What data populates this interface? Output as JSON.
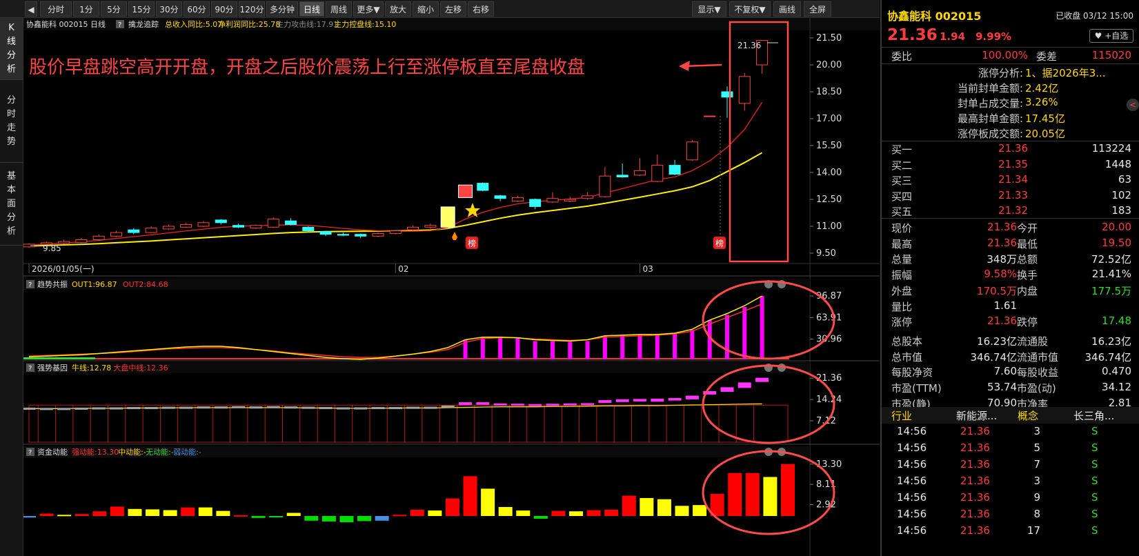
{
  "toolbar": {
    "items": [
      "分时",
      "1分",
      "5分",
      "15分",
      "30分",
      "60分",
      "90分",
      "120分",
      "多分钟",
      "日线",
      "周线",
      "更多▼",
      "放大",
      "缩小",
      "左移",
      "右移"
    ],
    "active": "日线",
    "right_items": [
      "显示▼",
      "不复权▼",
      "画线",
      "全屏"
    ]
  },
  "sidebar": {
    "tabs": [
      {
        "label": "K\n线\n分\n析",
        "active": true
      },
      {
        "label": "分\n时\n走\n势",
        "active": false
      },
      {
        "label": "基\n本\n面\n分\n析",
        "active": false
      }
    ]
  },
  "main_chart": {
    "header": {
      "name": "协鑫能科 002015 日线",
      "indicator": "擒龙追踪",
      "items": [
        {
          "label": "总收入同比:5.07",
          "color": "#ffd800"
        },
        {
          "label": "净利润同比:25.78",
          "color": "#ffd800"
        },
        {
          "label": "主力攻击线:17.91",
          "color": "#888888"
        },
        {
          "label": "主力控盘线:15.10",
          "color": "#ffd800"
        }
      ]
    },
    "y_ticks": [
      "21.50",
      "20.00",
      "18.50",
      "17.00",
      "15.50",
      "14.00",
      "12.50",
      "11.00",
      "9.50"
    ],
    "y_range": [
      9.0,
      22.0
    ],
    "x_labels": [
      {
        "label": "2026/01/05(一)",
        "index": 0
      },
      {
        "label": "02",
        "index": 21
      },
      {
        "label": "03",
        "index": 35
      }
    ],
    "annotation": "股价早盘跳空高开开盘，开盘之后股价震荡上行至涨停板直至尾盘收盘",
    "low_label": "9.85",
    "high_label": "21.36",
    "badge": "榜",
    "candles": [
      [
        9.85,
        10.0,
        10.05,
        9.8
      ],
      [
        10.0,
        10.08,
        10.15,
        9.95
      ],
      [
        10.05,
        10.15,
        10.25,
        10.0
      ],
      [
        10.1,
        10.25,
        10.35,
        10.05
      ],
      [
        10.25,
        10.45,
        10.55,
        10.2
      ],
      [
        10.45,
        10.65,
        10.75,
        10.4
      ],
      [
        10.8,
        10.65,
        10.9,
        10.55
      ],
      [
        10.65,
        10.9,
        11.0,
        10.6
      ],
      [
        10.85,
        11.0,
        11.1,
        10.8
      ],
      [
        10.95,
        11.1,
        11.2,
        10.9
      ],
      [
        11.0,
        11.2,
        11.3,
        10.95
      ],
      [
        11.35,
        11.2,
        11.4,
        11.1
      ],
      [
        11.05,
        10.95,
        11.15,
        10.9
      ],
      [
        10.9,
        11.05,
        11.1,
        10.85
      ],
      [
        10.95,
        11.4,
        11.5,
        10.9
      ],
      [
        11.3,
        11.1,
        11.45,
        11.05
      ],
      [
        10.95,
        10.75,
        11.0,
        10.65
      ],
      [
        10.7,
        10.55,
        10.75,
        10.45
      ],
      [
        10.55,
        10.5,
        10.65,
        10.45
      ],
      [
        10.55,
        10.45,
        10.6,
        10.35
      ],
      [
        10.45,
        10.6,
        10.65,
        10.4
      ],
      [
        10.6,
        10.75,
        10.8,
        10.55
      ],
      [
        10.8,
        10.95,
        11.05,
        10.75
      ],
      [
        10.95,
        11.05,
        11.15,
        10.85
      ],
      [
        10.95,
        12.08,
        12.08,
        10.95
      ],
      [
        12.6,
        13.3,
        13.3,
        12.6
      ],
      [
        13.4,
        13.0,
        13.45,
        12.95
      ],
      [
        12.7,
        12.55,
        12.75,
        12.4
      ],
      [
        12.4,
        12.6,
        12.7,
        12.35
      ],
      [
        12.5,
        12.1,
        12.55,
        11.95
      ],
      [
        12.35,
        12.55,
        12.9,
        12.3
      ],
      [
        12.4,
        12.5,
        12.65,
        12.35
      ],
      [
        12.55,
        12.7,
        12.9,
        12.5
      ],
      [
        12.65,
        13.8,
        14.3,
        12.6
      ],
      [
        13.85,
        13.75,
        14.5,
        13.7
      ],
      [
        13.85,
        14.1,
        14.8,
        13.8
      ],
      [
        13.5,
        14.4,
        15.0,
        13.45
      ],
      [
        14.4,
        13.9,
        14.7,
        13.85
      ],
      [
        14.7,
        15.7,
        15.8,
        14.65
      ],
      [
        17.15,
        17.15,
        17.15,
        17.15
      ],
      [
        18.5,
        18.2,
        18.8,
        17.05
      ],
      [
        17.85,
        19.35,
        19.55,
        17.45
      ],
      [
        20.0,
        21.36,
        21.36,
        19.5
      ]
    ],
    "ma_fast": [
      9.95,
      10.0,
      10.07,
      10.13,
      10.21,
      10.32,
      10.42,
      10.52,
      10.63,
      10.74,
      10.84,
      10.94,
      11.0,
      11.03,
      11.06,
      11.08,
      11.05,
      10.97,
      10.88,
      10.8,
      10.75,
      10.72,
      10.72,
      10.75,
      10.93,
      11.4,
      11.78,
      12.05,
      12.25,
      12.36,
      12.45,
      12.52,
      12.6,
      12.86,
      13.1,
      13.35,
      13.6,
      13.75,
      14.1,
      14.65,
      15.4,
      16.4,
      17.91
    ],
    "ma_slow": [
      9.9,
      9.93,
      9.96,
      9.99,
      10.03,
      10.08,
      10.13,
      10.18,
      10.24,
      10.3,
      10.36,
      10.42,
      10.48,
      10.54,
      10.6,
      10.65,
      10.68,
      10.7,
      10.71,
      10.72,
      10.73,
      10.74,
      10.76,
      10.79,
      10.88,
      11.05,
      11.25,
      11.45,
      11.62,
      11.76,
      11.88,
      12.0,
      12.12,
      12.28,
      12.45,
      12.62,
      12.8,
      12.98,
      13.2,
      13.55,
      14.05,
      14.55,
      15.1
    ]
  },
  "panel1": {
    "name": "趋势共振",
    "items": [
      {
        "label": "OUT1:96.87",
        "color": "#ffd800"
      },
      {
        "label": "OUT2:84.68",
        "color": "#ff3030"
      }
    ],
    "y_ticks": [
      "96.87",
      "63.91",
      "30.96"
    ],
    "y_max": 100,
    "bars": [
      0,
      0,
      0,
      0,
      0,
      0,
      0,
      0,
      0,
      0,
      0,
      0,
      0,
      0,
      0,
      0,
      0,
      0,
      0,
      0,
      0,
      0,
      0,
      0,
      0,
      30,
      34,
      34,
      33,
      28,
      28,
      27,
      28,
      36,
      37,
      38,
      38,
      40,
      45,
      60,
      68,
      80,
      96.87
    ],
    "out1": [
      4,
      5,
      6,
      7,
      9,
      11,
      13,
      15,
      17,
      19,
      20,
      20,
      18,
      15,
      12,
      9,
      6,
      3,
      1,
      0,
      2,
      5,
      8,
      12,
      18,
      30,
      34,
      34,
      33,
      30,
      29,
      28,
      30,
      36,
      37,
      38,
      38,
      40,
      46,
      60,
      70,
      82,
      96.87
    ],
    "out2": [
      5,
      6,
      7,
      8,
      9,
      10,
      12,
      14,
      16,
      17,
      18,
      18,
      17,
      15,
      13,
      10,
      8,
      6,
      4,
      3,
      3,
      5,
      8,
      11,
      15,
      26,
      32,
      33,
      33,
      31,
      30,
      29,
      30,
      34,
      35,
      36,
      37,
      39,
      43,
      54,
      64,
      74,
      84.68
    ]
  },
  "panel2": {
    "name": "强势基因",
    "items": [
      {
        "label": "牛线:12.78",
        "color": "#ffd800"
      },
      {
        "label": "大盘中线:12.36",
        "color": "#ff3030"
      }
    ],
    "y_ticks": [
      "21.36",
      "14.24",
      "7.12"
    ],
    "y_max": 23,
    "boxes": [
      [
        11.2,
        11.4,
        "g"
      ],
      [
        11.1,
        11.3,
        "g"
      ],
      [
        11.1,
        11.3,
        "g"
      ],
      [
        11.2,
        11.4,
        "g"
      ],
      [
        11.3,
        11.5,
        "g"
      ],
      [
        11.3,
        11.5,
        "g"
      ],
      [
        11.4,
        11.6,
        "g"
      ],
      [
        11.4,
        11.6,
        "g"
      ],
      [
        11.5,
        11.7,
        "g"
      ],
      [
        11.5,
        11.7,
        "g"
      ],
      [
        11.6,
        11.8,
        "g"
      ],
      [
        11.6,
        11.8,
        "g"
      ],
      [
        11.7,
        11.9,
        "g"
      ],
      [
        11.6,
        11.8,
        "g"
      ],
      [
        11.7,
        11.9,
        "g"
      ],
      [
        11.6,
        11.8,
        "g"
      ],
      [
        11.5,
        11.7,
        "g"
      ],
      [
        11.4,
        11.6,
        "g"
      ],
      [
        11.3,
        11.5,
        "g"
      ],
      [
        11.3,
        11.5,
        "g"
      ],
      [
        11.4,
        11.6,
        "g"
      ],
      [
        11.4,
        11.6,
        "g"
      ],
      [
        11.5,
        11.7,
        "g"
      ],
      [
        11.5,
        11.7,
        "g"
      ],
      [
        11.6,
        12.1,
        "g"
      ],
      [
        12.5,
        13.2,
        "m"
      ],
      [
        12.6,
        13.2,
        "m"
      ],
      [
        12.4,
        12.8,
        "m"
      ],
      [
        12.3,
        12.7,
        "m"
      ],
      [
        12.2,
        12.6,
        "m"
      ],
      [
        12.3,
        12.7,
        "m"
      ],
      [
        12.4,
        12.8,
        "m"
      ],
      [
        12.5,
        12.9,
        "m"
      ],
      [
        13.2,
        13.9,
        "m"
      ],
      [
        13.5,
        14.2,
        "m"
      ],
      [
        13.7,
        14.3,
        "m"
      ],
      [
        13.6,
        14.4,
        "m"
      ],
      [
        14.0,
        14.6,
        "m"
      ],
      [
        14.4,
        15.4,
        "m"
      ],
      [
        16.0,
        16.9,
        "m"
      ],
      [
        16.9,
        18.2,
        "m"
      ],
      [
        18.2,
        19.8,
        "m"
      ],
      [
        20.2,
        21.36,
        "m"
      ]
    ],
    "red_line": 12.36,
    "yellow_line": [
      11.2,
      11.2,
      11.2,
      11.3,
      11.3,
      11.3,
      11.4,
      11.4,
      11.4,
      11.5,
      11.5,
      11.5,
      11.5,
      11.5,
      11.5,
      11.5,
      11.4,
      11.4,
      11.3,
      11.3,
      11.3,
      11.4,
      11.4,
      11.4,
      11.5,
      11.6,
      11.7,
      11.8,
      11.8,
      11.8,
      11.9,
      11.9,
      12.0,
      12.1,
      12.1,
      12.2,
      12.2,
      12.3,
      12.4,
      12.5,
      12.6,
      12.7,
      12.78
    ]
  },
  "panel3": {
    "name": "资金动能",
    "items": [
      {
        "label": "强动能:13.30",
        "color": "#ff3030"
      },
      {
        "label": "中动能:-",
        "color": "#ffd800"
      },
      {
        "label": "无动能:-",
        "color": "#2fdc2f"
      },
      {
        "label": "弱动能:-",
        "color": "#4a90e2"
      }
    ],
    "y_ticks": [
      "13.30",
      "8.11",
      "2.92"
    ],
    "y_max": 14.5,
    "bars": [
      [
        -0.4,
        "b"
      ],
      [
        0.6,
        "r"
      ],
      [
        0.3,
        "y"
      ],
      [
        0.5,
        "r"
      ],
      [
        1.2,
        "r"
      ],
      [
        2.4,
        "r"
      ],
      [
        1.8,
        "y"
      ],
      [
        1.7,
        "y"
      ],
      [
        1.5,
        "y"
      ],
      [
        2.2,
        "r"
      ],
      [
        2.2,
        "y"
      ],
      [
        1.3,
        "y"
      ],
      [
        0.2,
        "r"
      ],
      [
        -0.5,
        "g"
      ],
      [
        -0.3,
        "g"
      ],
      [
        0.8,
        "y"
      ],
      [
        -1.2,
        "g"
      ],
      [
        -1.4,
        "g"
      ],
      [
        -1.6,
        "g"
      ],
      [
        -1.3,
        "g"
      ],
      [
        -1.2,
        "b"
      ],
      [
        0.3,
        "r"
      ],
      [
        1.6,
        "r"
      ],
      [
        1.4,
        "y"
      ],
      [
        4.5,
        "r"
      ],
      [
        10.2,
        "r"
      ],
      [
        7.0,
        "y"
      ],
      [
        2.3,
        "y"
      ],
      [
        1.4,
        "y"
      ],
      [
        -0.7,
        "g"
      ],
      [
        1.3,
        "r"
      ],
      [
        1.2,
        "y"
      ],
      [
        1.5,
        "r"
      ],
      [
        1.6,
        "r"
      ],
      [
        5.2,
        "r"
      ],
      [
        4.6,
        "y"
      ],
      [
        4.3,
        "y"
      ],
      [
        2.6,
        "y"
      ],
      [
        2.8,
        "y"
      ],
      [
        5.7,
        "r"
      ],
      [
        11.0,
        "r"
      ],
      [
        11.0,
        "r"
      ],
      [
        10.0,
        "y"
      ],
      [
        13.3,
        "r"
      ]
    ]
  },
  "quote": {
    "name": "协鑫能科 002015",
    "status": "已收盘 03/12 15:00",
    "price": "21.36",
    "change": "1.94",
    "pct": "9.99%",
    "watch": "♥ +自选",
    "weibi_label": "委比",
    "weibi": "100.00%",
    "weicha_label": "委差",
    "weicha": "115020",
    "limit_info": [
      {
        "label": "涨停分析:",
        "value": "1、据2026年3..."
      },
      {
        "label": "当前封单金额:",
        "value": "2.42亿"
      },
      {
        "label": "封单占成交量:",
        "value": "3.26%"
      },
      {
        "label": "最高封单金额:",
        "value": "17.45亿"
      },
      {
        "label": "涨停板成交额:",
        "value": "20.05亿"
      }
    ],
    "bids": [
      {
        "label": "买一",
        "price": "21.36",
        "vol": "113224"
      },
      {
        "label": "买二",
        "price": "21.35",
        "vol": "1448"
      },
      {
        "label": "买三",
        "price": "21.34",
        "vol": "63"
      },
      {
        "label": "买四",
        "price": "21.33",
        "vol": "102"
      },
      {
        "label": "买五",
        "price": "21.32",
        "vol": "183"
      }
    ],
    "stats": [
      {
        "l1": "现价",
        "v1": "21.36",
        "c1": "red",
        "l2": "今开",
        "v2": "20.00",
        "c2": "red"
      },
      {
        "l1": "最高",
        "v1": "21.36",
        "c1": "red",
        "l2": "最低",
        "v2": "19.50",
        "c2": "red"
      },
      {
        "l1": "总量",
        "v1": "348万",
        "c1": "white",
        "l2": "总额",
        "v2": "72.52亿",
        "c2": "white"
      },
      {
        "l1": "振幅",
        "v1": "9.58%",
        "c1": "red",
        "l2": "换手",
        "v2": "21.41%",
        "c2": "white"
      },
      {
        "l1": "外盘",
        "v1": "170.5万",
        "c1": "red",
        "l2": "内盘",
        "v2": "177.5万",
        "c2": "green"
      },
      {
        "l1": "量比",
        "v1": "1.61",
        "c1": "white",
        "l2": "",
        "v2": "",
        "c2": "white"
      },
      {
        "l1": "涨停",
        "v1": "21.36",
        "c1": "red",
        "l2": "跌停",
        "v2": "17.48",
        "c2": "green"
      },
      {
        "l1": "总股本",
        "v1": "16.23亿",
        "c1": "white",
        "l2": "流通股",
        "v2": "16.23亿",
        "c2": "white"
      },
      {
        "l1": "总市值",
        "v1": "346.74亿",
        "c1": "white",
        "l2": "流通市值",
        "v2": "346.74亿",
        "c2": "white"
      },
      {
        "l1": "每股净资",
        "v1": "7.60",
        "c1": "white",
        "l2": "每股收益",
        "v2": "0.470",
        "c2": "white"
      },
      {
        "l1": "市盈(TTM)",
        "v1": "53.74",
        "c1": "white",
        "l2": "市盈(动)",
        "v2": "34.12",
        "c2": "white"
      },
      {
        "l1": "市盈(静)",
        "v1": "70.90",
        "c1": "white",
        "l2": "市净率",
        "v2": "2.81",
        "c2": "white"
      }
    ],
    "industry_label": "行业",
    "industry": "新能源...",
    "concept_label": "概念",
    "concept": "长三角...",
    "ticks": [
      {
        "time": "14:56",
        "price": "21.36",
        "vol": "3",
        "dir": "S"
      },
      {
        "time": "14:56",
        "price": "21.36",
        "vol": "5",
        "dir": "S"
      },
      {
        "time": "14:56",
        "price": "21.36",
        "vol": "7",
        "dir": "S"
      },
      {
        "time": "14:56",
        "price": "21.36",
        "vol": "3",
        "dir": "S"
      },
      {
        "time": "14:56",
        "price": "21.36",
        "vol": "9",
        "dir": "S"
      },
      {
        "time": "14:56",
        "price": "21.36",
        "vol": "8",
        "dir": "S"
      },
      {
        "time": "14:56",
        "price": "21.36",
        "vol": "17",
        "dir": "S"
      }
    ]
  }
}
